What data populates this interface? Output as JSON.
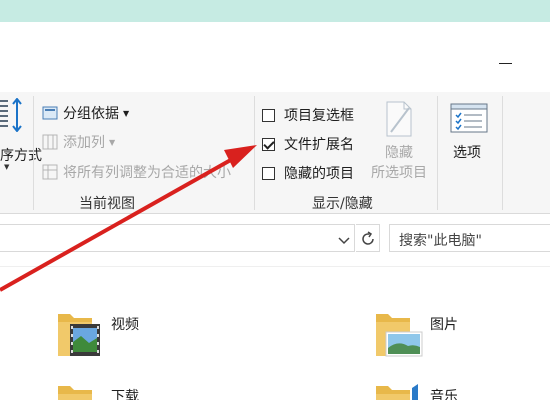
{
  "window": {
    "minimize_label": "Minimize"
  },
  "ribbon": {
    "sort": {
      "label": "序方式",
      "icon": "sort-by-icon"
    },
    "current_view": {
      "group_label": "当前视图",
      "group_by": "分组依据",
      "add_columns": "添加列",
      "fit_columns": "将所有列调整为合适的大小"
    },
    "show_hide": {
      "group_label": "显示/隐藏",
      "item_checkboxes": {
        "label": "项目复选框",
        "checked": false
      },
      "file_extensions": {
        "label": "文件扩展名",
        "checked": true
      },
      "hidden_items": {
        "label": "隐藏的项目",
        "checked": false
      },
      "hide_selected_line1": "隐藏",
      "hide_selected_line2": "所选项目"
    },
    "options": {
      "label": "选项"
    }
  },
  "address_bar": {
    "search_placeholder": "搜索\"此电脑\""
  },
  "folders": [
    {
      "name": "视频",
      "icon": "videos-folder-icon"
    },
    {
      "name": "图片",
      "icon": "pictures-folder-icon"
    },
    {
      "name": "下载",
      "icon": "downloads-folder-icon"
    },
    {
      "name": "音乐",
      "icon": "music-folder-icon"
    }
  ],
  "colors": {
    "arrow": "#d9211e",
    "accent": "#1a73c8",
    "folder": "#f1c96a"
  }
}
